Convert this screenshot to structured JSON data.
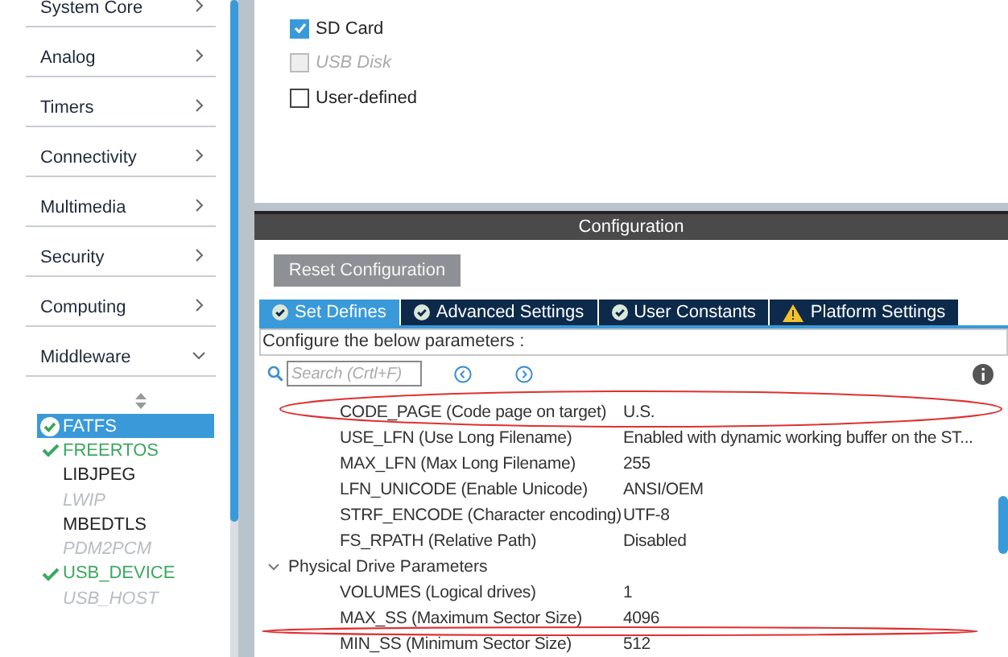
{
  "sidebar": {
    "categories": [
      {
        "label": "System Core",
        "expanded": false
      },
      {
        "label": "Analog",
        "expanded": false
      },
      {
        "label": "Timers",
        "expanded": false
      },
      {
        "label": "Connectivity",
        "expanded": false
      },
      {
        "label": "Multimedia",
        "expanded": false
      },
      {
        "label": "Security",
        "expanded": false
      },
      {
        "label": "Computing",
        "expanded": false
      },
      {
        "label": "Middleware",
        "expanded": true
      }
    ],
    "items": [
      {
        "label": "FATFS",
        "checked": true,
        "disabled": false,
        "selected": true
      },
      {
        "label": "FREERTOS",
        "checked": true,
        "disabled": false,
        "selected": false
      },
      {
        "label": "LIBJPEG",
        "checked": false,
        "disabled": false,
        "selected": false
      },
      {
        "label": "LWIP",
        "checked": false,
        "disabled": true,
        "selected": false
      },
      {
        "label": "MBEDTLS",
        "checked": false,
        "disabled": false,
        "selected": false
      },
      {
        "label": "PDM2PCM",
        "checked": false,
        "disabled": true,
        "selected": false
      },
      {
        "label": "USB_DEVICE",
        "checked": true,
        "disabled": false,
        "selected": false
      },
      {
        "label": "USB_HOST",
        "checked": false,
        "disabled": true,
        "selected": false
      }
    ]
  },
  "mode": {
    "options": [
      {
        "label": "SD Card",
        "checked": true,
        "disabled": false
      },
      {
        "label": "USB Disk",
        "checked": false,
        "disabled": true
      },
      {
        "label": "User-defined",
        "checked": false,
        "disabled": false
      }
    ]
  },
  "configuration": {
    "title": "Configuration",
    "reset_button": "Reset Configuration",
    "tabs": [
      {
        "label": "Set Defines",
        "kind": "check",
        "selected": true
      },
      {
        "label": "Advanced Settings",
        "kind": "check",
        "selected": false
      },
      {
        "label": "User Constants",
        "kind": "check",
        "selected": false
      },
      {
        "label": "Platform Settings",
        "kind": "warning",
        "selected": false
      }
    ],
    "hint": "Configure the below parameters :",
    "search": {
      "placeholder": "Search (Crtl+F)"
    },
    "parameters": [
      {
        "kind": "param",
        "name": "CODE_PAGE (Code page on target)",
        "value": "U.S."
      },
      {
        "kind": "param",
        "name": "USE_LFN (Use Long Filename)",
        "value": "Enabled with dynamic working buffer on the ST..."
      },
      {
        "kind": "param",
        "name": "MAX_LFN (Max Long Filename)",
        "value": "255"
      },
      {
        "kind": "param",
        "name": "LFN_UNICODE (Enable Unicode)",
        "value": "ANSI/OEM"
      },
      {
        "kind": "param",
        "name": "STRF_ENCODE (Character encoding)",
        "value": "UTF-8"
      },
      {
        "kind": "param",
        "name": "FS_RPATH (Relative Path)",
        "value": "Disabled"
      },
      {
        "kind": "group",
        "name": "Physical Drive Parameters",
        "expanded": true
      },
      {
        "kind": "param",
        "name": "VOLUMES (Logical drives)",
        "value": "1"
      },
      {
        "kind": "param",
        "name": "MAX_SS (Maximum Sector Size)",
        "value": "4096"
      },
      {
        "kind": "param",
        "name": "MIN_SS (Minimum Sector Size)",
        "value": "512"
      }
    ]
  }
}
